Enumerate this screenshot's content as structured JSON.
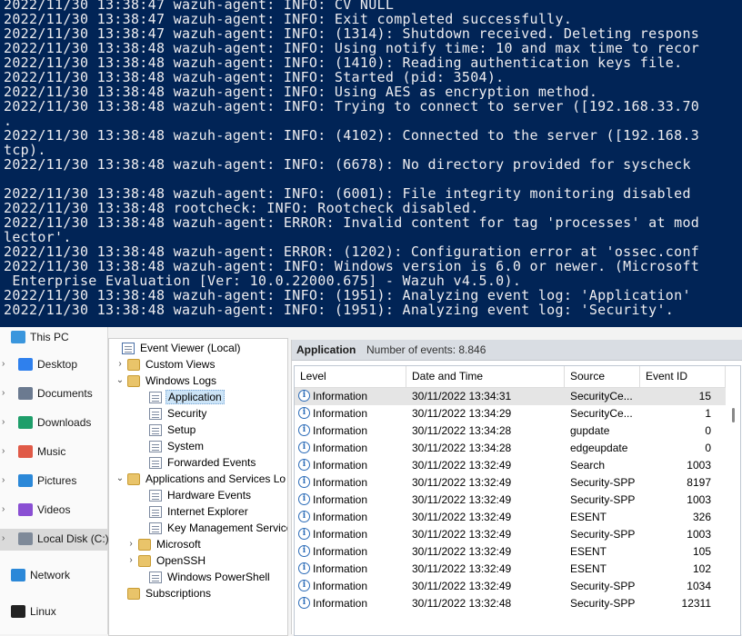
{
  "terminal": {
    "lines": [
      "2022/11/30 13:38:47 wazuh-agent: INFO: CV NULL",
      "2022/11/30 13:38:47 wazuh-agent: INFO: Exit completed successfully.",
      "2022/11/30 13:38:47 wazuh-agent: INFO: (1314): Shutdown received. Deleting respons",
      "2022/11/30 13:38:48 wazuh-agent: INFO: Using notify time: 10 and max time to recor",
      "2022/11/30 13:38:48 wazuh-agent: INFO: (1410): Reading authentication keys file.",
      "2022/11/30 13:38:48 wazuh-agent: INFO: Started (pid: 3504).",
      "2022/11/30 13:38:48 wazuh-agent: INFO: Using AES as encryption method.",
      "2022/11/30 13:38:48 wazuh-agent: INFO: Trying to connect to server ([192.168.33.70",
      ".",
      "2022/11/30 13:38:48 wazuh-agent: INFO: (4102): Connected to the server ([192.168.3",
      "tcp).",
      "2022/11/30 13:38:48 wazuh-agent: INFO: (6678): No directory provided for syscheck",
      "",
      "2022/11/30 13:38:48 wazuh-agent: INFO: (6001): File integrity monitoring disabled",
      "2022/11/30 13:38:48 rootcheck: INFO: Rootcheck disabled.",
      "2022/11/30 13:38:48 wazuh-agent: ERROR: Invalid content for tag 'processes' at mod",
      "lector'.",
      "2022/11/30 13:38:48 wazuh-agent: ERROR: (1202): Configuration error at 'ossec.conf",
      "2022/11/30 13:38:48 wazuh-agent: INFO: Windows version is 6.0 or newer. (Microsoft",
      " Enterprise Evaluation [Ver: 10.0.22000.675] - Wazuh v4.5.0).",
      "2022/11/30 13:38:48 wazuh-agent: INFO: (1951): Analyzing event log: 'Application'",
      "2022/11/30 13:38:48 wazuh-agent: INFO: (1951): Analyzing event log: 'Security'."
    ]
  },
  "explorer_nav": {
    "items": [
      {
        "label": "This PC",
        "icon": "monitor-icon",
        "color": "#3a96dd"
      },
      {
        "label": "Desktop",
        "icon": "desktop-folder-icon",
        "color": "#2f80ed"
      },
      {
        "label": "Documents",
        "icon": "documents-icon",
        "color": "#6b7a90"
      },
      {
        "label": "Downloads",
        "icon": "download-icon",
        "color": "#1e9e6a"
      },
      {
        "label": "Music",
        "icon": "music-icon",
        "color": "#e05a47"
      },
      {
        "label": "Pictures",
        "icon": "pictures-icon",
        "color": "#2b88d8"
      },
      {
        "label": "Videos",
        "icon": "videos-icon",
        "color": "#8a4fd3"
      },
      {
        "label": "Local Disk (C:)",
        "icon": "drive-icon",
        "color": "#7f8a99"
      },
      {
        "label": "Network",
        "icon": "network-icon",
        "color": "#2b88d8"
      },
      {
        "label": "Linux",
        "icon": "linux-penguin-icon",
        "color": "#222222"
      }
    ]
  },
  "tree": {
    "items": [
      {
        "label": "Event Viewer (Local)",
        "icon": "event-viewer-icon",
        "expander": ""
      },
      {
        "label": "Custom Views",
        "icon": "folder-icon",
        "expander": "›"
      },
      {
        "label": "Windows Logs",
        "icon": "folder-icon",
        "expander": "⌄"
      },
      {
        "label": "Application",
        "icon": "log-icon",
        "expander": ""
      },
      {
        "label": "Security",
        "icon": "log-icon",
        "expander": ""
      },
      {
        "label": "Setup",
        "icon": "log-icon",
        "expander": ""
      },
      {
        "label": "System",
        "icon": "log-icon",
        "expander": ""
      },
      {
        "label": "Forwarded Events",
        "icon": "log-icon",
        "expander": ""
      },
      {
        "label": "Applications and Services Lo",
        "icon": "folder-icon",
        "expander": "⌄"
      },
      {
        "label": "Hardware Events",
        "icon": "log-icon",
        "expander": ""
      },
      {
        "label": "Internet Explorer",
        "icon": "log-icon",
        "expander": ""
      },
      {
        "label": "Key Management Service",
        "icon": "log-icon",
        "expander": ""
      },
      {
        "label": "Microsoft",
        "icon": "folder-icon",
        "expander": "›"
      },
      {
        "label": "OpenSSH",
        "icon": "folder-icon",
        "expander": "›"
      },
      {
        "label": "Windows PowerShell",
        "icon": "log-icon",
        "expander": ""
      },
      {
        "label": "Subscriptions",
        "icon": "subscriptions-icon",
        "expander": ""
      }
    ]
  },
  "events": {
    "pane_name": "Application",
    "count_text": "Number of events: 8.846",
    "columns": [
      "Level",
      "Date and Time",
      "Source",
      "Event ID"
    ],
    "rows": [
      {
        "level": "Information",
        "datetime": "30/11/2022 13:34:31",
        "source": "SecurityCe...",
        "id": "15"
      },
      {
        "level": "Information",
        "datetime": "30/11/2022 13:34:29",
        "source": "SecurityCe...",
        "id": "1"
      },
      {
        "level": "Information",
        "datetime": "30/11/2022 13:34:28",
        "source": "gupdate",
        "id": "0"
      },
      {
        "level": "Information",
        "datetime": "30/11/2022 13:34:28",
        "source": "edgeupdate",
        "id": "0"
      },
      {
        "level": "Information",
        "datetime": "30/11/2022 13:32:49",
        "source": "Search",
        "id": "1003"
      },
      {
        "level": "Information",
        "datetime": "30/11/2022 13:32:49",
        "source": "Security-SPP",
        "id": "8197"
      },
      {
        "level": "Information",
        "datetime": "30/11/2022 13:32:49",
        "source": "Security-SPP",
        "id": "1003"
      },
      {
        "level": "Information",
        "datetime": "30/11/2022 13:32:49",
        "source": "ESENT",
        "id": "326"
      },
      {
        "level": "Information",
        "datetime": "30/11/2022 13:32:49",
        "source": "Security-SPP",
        "id": "1003"
      },
      {
        "level": "Information",
        "datetime": "30/11/2022 13:32:49",
        "source": "ESENT",
        "id": "105"
      },
      {
        "level": "Information",
        "datetime": "30/11/2022 13:32:49",
        "source": "ESENT",
        "id": "102"
      },
      {
        "level": "Information",
        "datetime": "30/11/2022 13:32:49",
        "source": "Security-SPP",
        "id": "1034"
      },
      {
        "level": "Information",
        "datetime": "30/11/2022 13:32:48",
        "source": "Security-SPP",
        "id": "12311"
      }
    ]
  },
  "colors": {
    "terminal_bg": "#012456",
    "terminal_fg": "#eeedf0",
    "info_icon": "#2c6cb8",
    "selection": "#cce4f7"
  }
}
